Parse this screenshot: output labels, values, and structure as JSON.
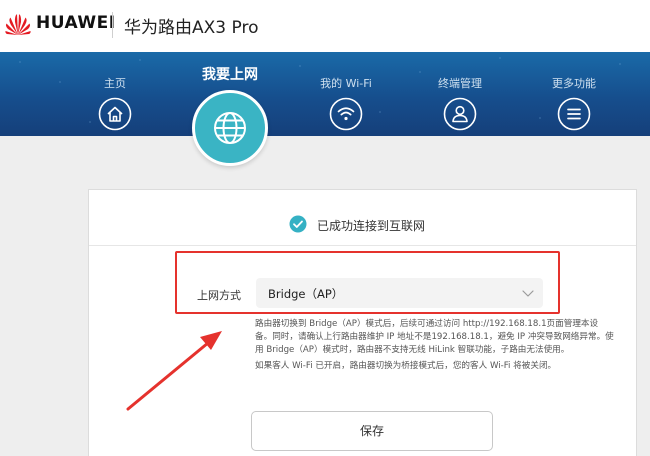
{
  "header": {
    "brand": "HUAWEI",
    "device_title": "华为路由AX3 Pro"
  },
  "nav": {
    "items": [
      {
        "label": "主页",
        "icon": "home-icon"
      },
      {
        "label": "我的 Wi-Fi",
        "icon": "wifi-icon"
      },
      {
        "label": "终端管理",
        "icon": "user-icon"
      },
      {
        "label": "更多功能",
        "icon": "menu-icon"
      }
    ],
    "active": {
      "label": "我要上网",
      "icon": "globe-icon"
    }
  },
  "status": {
    "text": "已成功连接到互联网",
    "icon": "check-circle-icon"
  },
  "form": {
    "mode_label": "上网方式",
    "mode_value": "Bridge（AP）",
    "help_1": "路由器切换到 Bridge（AP）模式后，后续可通过访问 http://192.168.18.1页面管理本设备。同时，请确认上行路由器维护 IP 地址不是192.168.18.1，避免 IP 冲突导致网络异常。使用 Bridge（AP）模式时，路由器不支持无线 HiLink 智联功能，子路由无法使用。",
    "help_2": "如果客人 Wi-Fi 已开启，路由器切换为桥接模式后，您的客人 Wi-Fi 将被关闭。",
    "save_label": "保存"
  },
  "colors": {
    "nav_bg": "#164e8d",
    "active_circle": "#3ab4c4",
    "status_check": "#35b1c4",
    "annotation_red": "#e5322d"
  }
}
